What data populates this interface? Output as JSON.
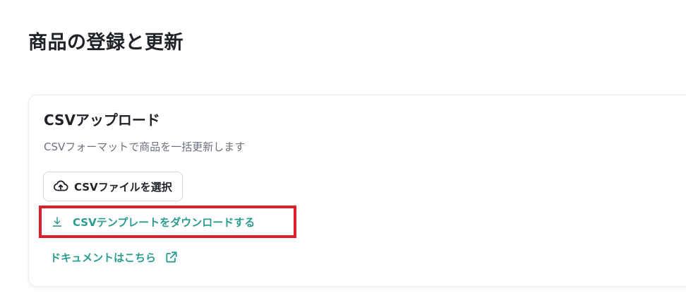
{
  "page": {
    "title": "商品の登録と更新"
  },
  "csv_upload": {
    "title": "CSVアップロード",
    "description": "CSVフォーマットで商品を一括更新します",
    "select_file_label": "CSVファイルを選択",
    "template_download_label": "CSVテンプレートをダウンロードする",
    "docs_link_label": "ドキュメントはこちら"
  },
  "icons": {
    "upload": "cloud-upload-icon",
    "download": "download-icon",
    "external_link": "external-link-icon"
  },
  "colors": {
    "accent": "#2a9d8f",
    "highlight_border": "#e01e2b",
    "text": "#1f2328",
    "muted_text": "#6b7280"
  }
}
